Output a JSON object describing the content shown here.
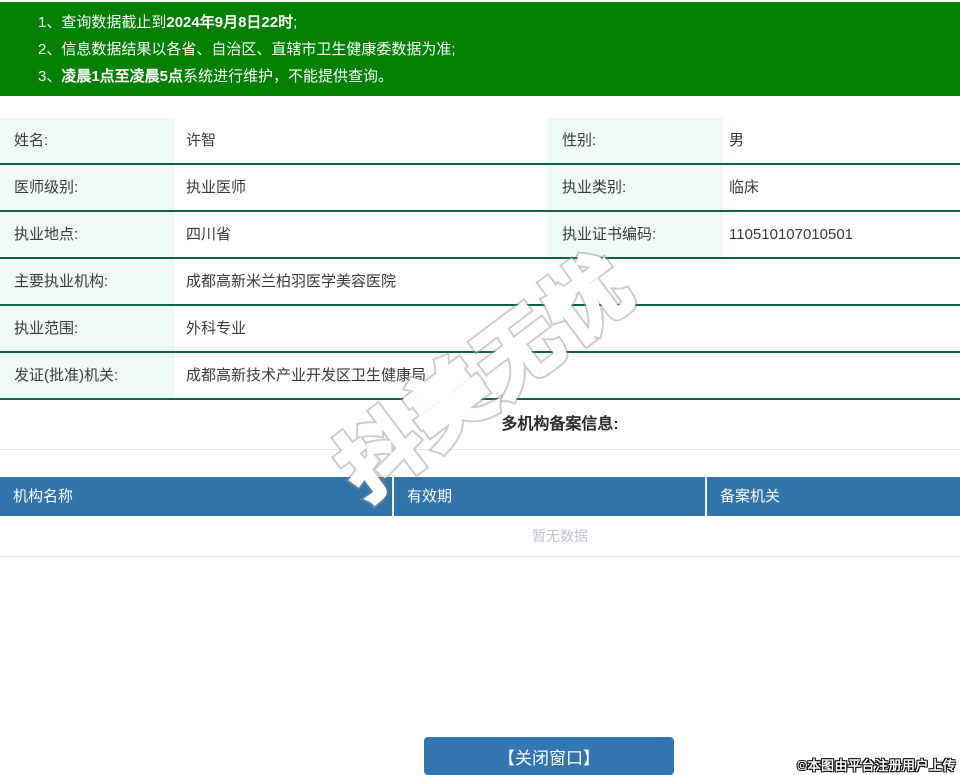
{
  "notice": {
    "items": [
      {
        "num": "1、",
        "pre": "查询数据截止到",
        "bold": "2024年9月8日22时",
        "post": ";"
      },
      {
        "num": "2、",
        "pre": "信息数据结果以各省、自治区、直辖市卫生健康委数据为准;",
        "bold": "",
        "post": ""
      },
      {
        "num": "3、",
        "pre": "",
        "bold": "凌晨1点至凌晨5点",
        "post": "系统进行维护，不能提供查询。"
      }
    ]
  },
  "info": {
    "rows2col": [
      {
        "label": "姓名:",
        "value": "许智",
        "label2": "性别:",
        "value2": "男"
      },
      {
        "label": "医师级别:",
        "value": "执业医师",
        "label2": "执业类别:",
        "value2": "临床"
      },
      {
        "label": "执业地点:",
        "value": "四川省",
        "label2": "执业证书编码:",
        "value2": "110510107010501"
      }
    ],
    "rows1col": [
      {
        "label": "主要执业机构:",
        "value": "成都高新米兰柏羽医学美容医院"
      },
      {
        "label": "执业范围:",
        "value": "外科专业"
      },
      {
        "label": "发证(批准)机关:",
        "value": "成都高新技术产业开发区卫生健康局"
      }
    ]
  },
  "filing": {
    "title": "多机构备案信息:",
    "headers": [
      "机构名称",
      "有效期",
      "备案机关"
    ],
    "empty_text": "暂无数据"
  },
  "footer": {
    "close_label": "【关闭窗口】",
    "credit": "©本图由平台注册用户上传"
  },
  "watermark": {
    "text": "抖美无忧"
  },
  "colors": {
    "banner_green": "#018001",
    "row_border_green": "#0d6342",
    "label_bg_green": "#eefaf3",
    "table_header_blue": "#3074ab",
    "button_blue": "#3276b1"
  }
}
